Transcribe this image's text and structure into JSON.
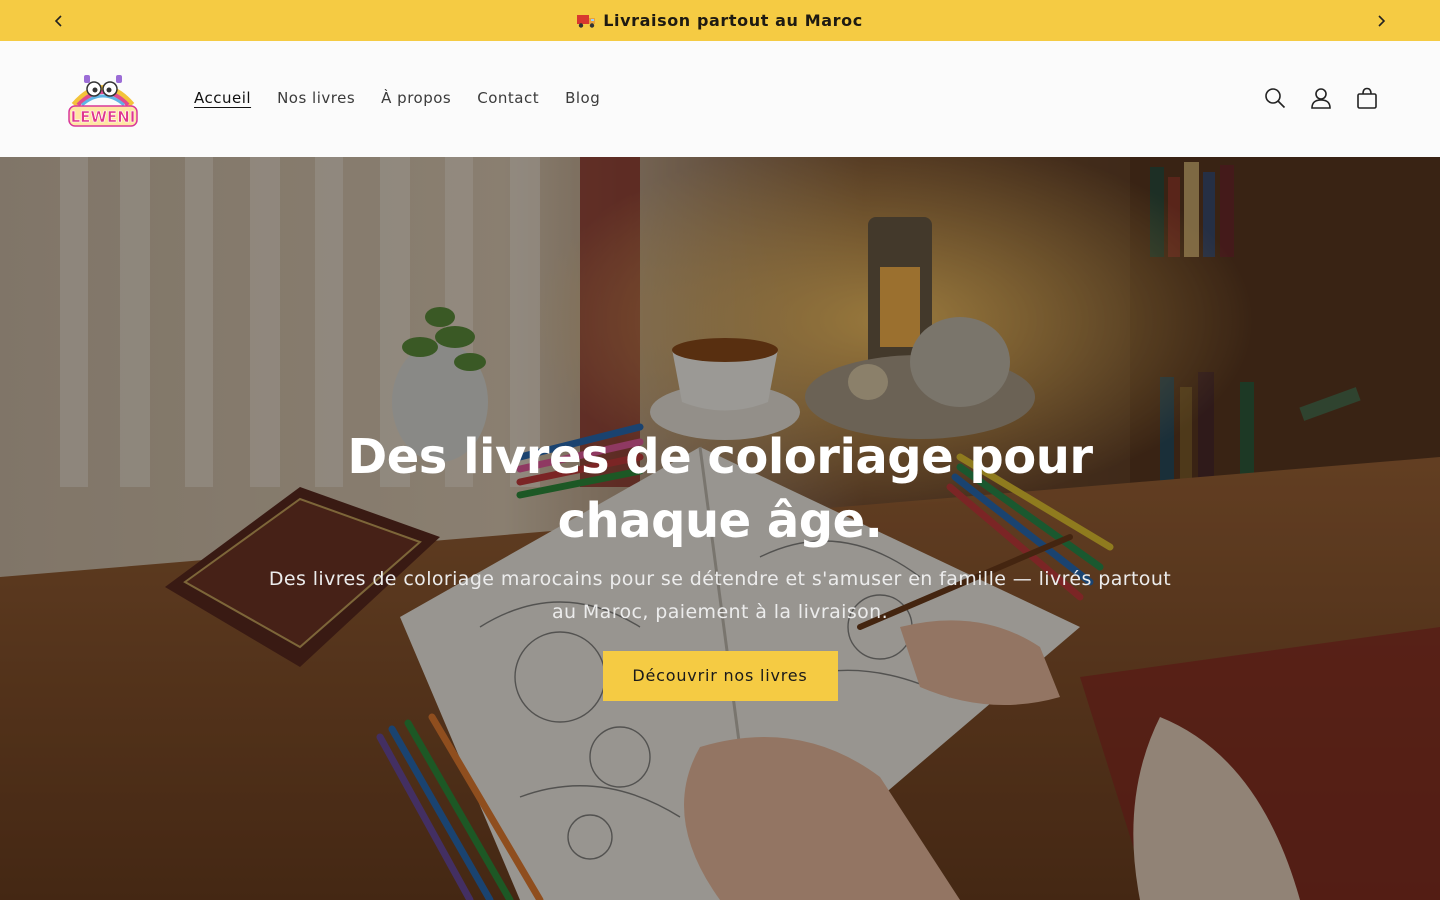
{
  "announcement": {
    "text": "Livraison partout au Maroc",
    "icon": "truck-icon",
    "prev_icon": "chevron-left-icon",
    "next_icon": "chevron-right-icon",
    "background": "#f5cb43"
  },
  "header": {
    "logo_text": "LEWENI",
    "nav": [
      {
        "label": "Accueil",
        "active": true
      },
      {
        "label": "Nos livres",
        "active": false
      },
      {
        "label": "À propos",
        "active": false
      },
      {
        "label": "Contact",
        "active": false
      },
      {
        "label": "Blog",
        "active": false
      }
    ],
    "icons": [
      "search-icon",
      "account-icon",
      "cart-icon"
    ]
  },
  "hero": {
    "title": "Des livres de coloriage pour chaque âge.",
    "subtitle": "Des livres de coloriage marocains pour se détendre et s'amuser en famille — livrés partout au Maroc, paiement à la livraison.",
    "cta_label": "Découvrir nos livres",
    "cta_color": "#f5cb43"
  }
}
